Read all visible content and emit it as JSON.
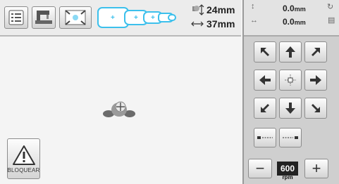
{
  "hoop": {
    "height_value": "24mm",
    "width_value": "37mm"
  },
  "lock_button": {
    "label": "BLOQUEAR"
  },
  "position": {
    "y_value": "0.0",
    "y_unit": "mm",
    "x_value": "0.0",
    "x_unit": "mm"
  },
  "speed": {
    "value": "600",
    "unit": "rpm",
    "minus_label": "−",
    "plus_label": "+"
  },
  "colors": {
    "hoop_accent": "#3cc0ec",
    "panel_bg": "#cfcfcf",
    "speed_box_bg": "#222222"
  }
}
